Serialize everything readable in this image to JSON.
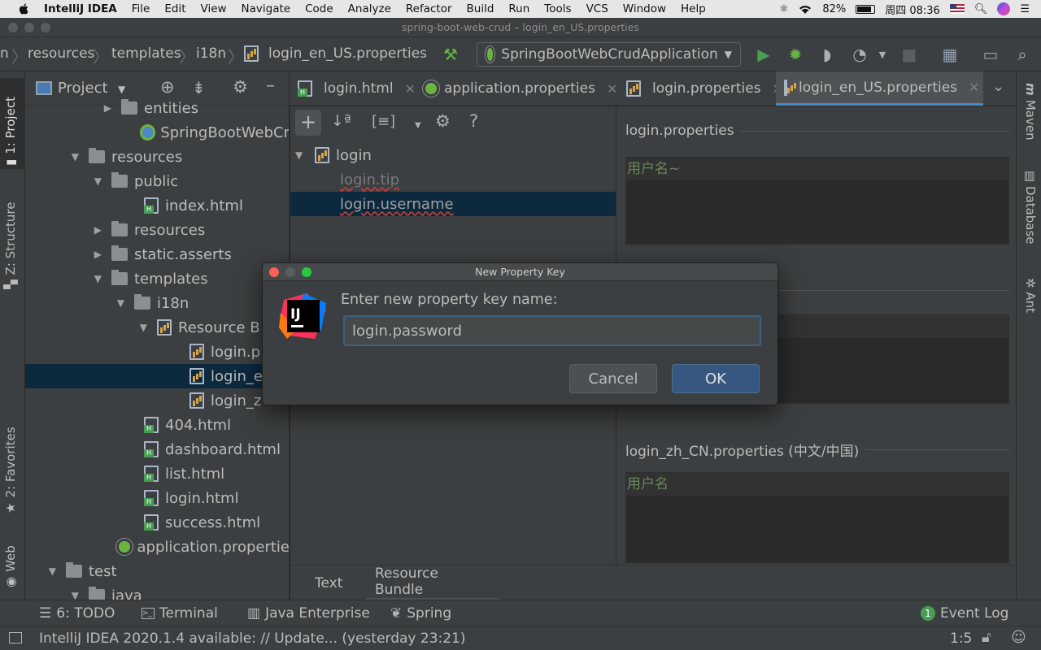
{
  "menubar": {
    "app": "IntelliJ IDEA",
    "items": [
      "File",
      "Edit",
      "View",
      "Navigate",
      "Code",
      "Analyze",
      "Refactor",
      "Build",
      "Run",
      "Tools",
      "VCS",
      "Window",
      "Help"
    ],
    "battery": "82%",
    "clock": "周四 08:36"
  },
  "window": {
    "title": "spring-boot-web-crud – login_en_US.properties"
  },
  "breadcrumb": {
    "items": [
      "n",
      "resources",
      "templates",
      "i18n",
      "login_en_US.properties"
    ]
  },
  "run_config": {
    "label": "SpringBootWebCrudApplication"
  },
  "left_stripe": {
    "project": "1: Project",
    "structure": "Z: Structure",
    "favorites": "2: Favorites",
    "web": "Web"
  },
  "right_stripe": {
    "maven": "Maven",
    "database": "Database",
    "ant": "Ant"
  },
  "project_panel": {
    "title": "Project",
    "rows": [
      {
        "label": "entities"
      },
      {
        "label": "SpringBootWebCr"
      },
      {
        "label": "resources"
      },
      {
        "label": "public"
      },
      {
        "label": "index.html"
      },
      {
        "label": "resources"
      },
      {
        "label": "static.asserts"
      },
      {
        "label": "templates"
      },
      {
        "label": "i18n"
      },
      {
        "label": "Resource B"
      },
      {
        "label": "login.p"
      },
      {
        "label": "login_e"
      },
      {
        "label": "login_z"
      },
      {
        "label": "404.html"
      },
      {
        "label": "dashboard.html"
      },
      {
        "label": "list.html"
      },
      {
        "label": "login.html"
      },
      {
        "label": "success.html"
      },
      {
        "label": "application.propertie"
      },
      {
        "label": "test"
      },
      {
        "label": "java"
      }
    ]
  },
  "editor_tabs": [
    {
      "label": "login.html"
    },
    {
      "label": "application.properties"
    },
    {
      "label": "login.properties"
    },
    {
      "label": "login_en_US.properties"
    }
  ],
  "bundle_tree": {
    "root": "login",
    "keys": [
      "login.tip",
      "login.username"
    ]
  },
  "values_panel": {
    "sections": [
      {
        "title": "login.properties",
        "value": "用户名~"
      },
      {
        "title": "s (英语/美国)",
        "value": ""
      },
      {
        "title": "login_zh_CN.properties (中文/中国)",
        "value": "用户名"
      }
    ]
  },
  "editor_bottom_tabs": {
    "text": "Text",
    "bundle": "Resource Bundle"
  },
  "tool_windows": {
    "todo": "6: TODO",
    "terminal": "Terminal",
    "java_enterprise": "Java Enterprise",
    "spring": "Spring",
    "event_log_count": "1",
    "event_log": "Event Log"
  },
  "status": {
    "message": "IntelliJ IDEA 2020.1.4 available: // Update... (yesterday 23:21)",
    "position": "1:5"
  },
  "dialog": {
    "title": "New Property Key",
    "prompt": "Enter new property key name:",
    "value": "login.password",
    "cancel": "Cancel",
    "ok": "OK",
    "logo_text": "IJ"
  }
}
